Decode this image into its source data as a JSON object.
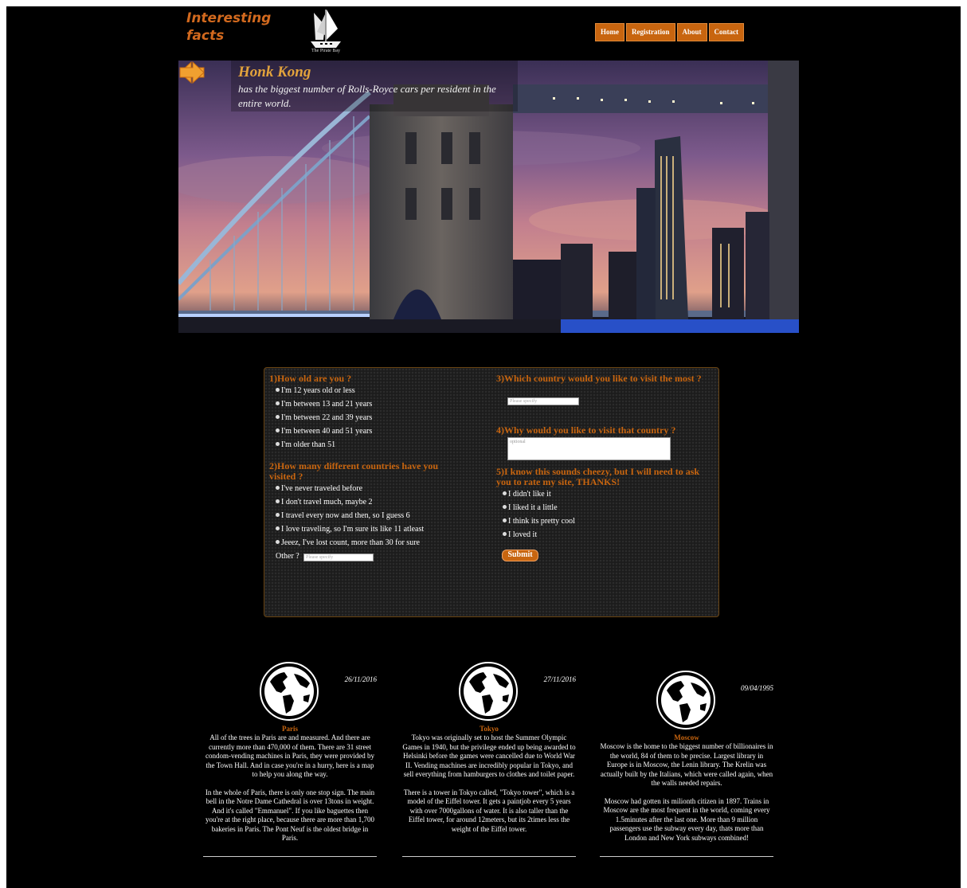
{
  "header": {
    "logo_line1": "Interesting",
    "logo_line2": "facts",
    "brand_caption": "The Pirate Bay"
  },
  "nav": [
    {
      "label": "Home"
    },
    {
      "label": "Registration"
    },
    {
      "label": "About"
    },
    {
      "label": "Contact"
    }
  ],
  "slider": {
    "title": "Honk Kong",
    "text": "has the biggest number of Rolls-Royce cars per resident in the entire world."
  },
  "survey": {
    "q1": {
      "label": "1)How old are you ?",
      "options": [
        "I'm 12 years old or less",
        "I'm between 13 and 21 years",
        "I'm between 22 and 39 years",
        "I'm between 40 and 51 years",
        "I'm older than 51"
      ]
    },
    "q2": {
      "label": "2)How many different countries have you visited ?",
      "options": [
        "I've never traveled before",
        "I don't travel much, maybe 2",
        "I travel every now and then, so I guess 6",
        "I love traveling, so I'm sure its like 11 atleast",
        "Jeeez, I've lost count, more than 30 for sure"
      ],
      "other_label": "Other ?",
      "other_placeholder": "Please specify"
    },
    "q3": {
      "label": "3)Which country would you like to visit the most ?",
      "placeholder": "Please specify"
    },
    "q4": {
      "label": "4)Why would you like to visit that country ?",
      "placeholder": "optional"
    },
    "q5": {
      "label": "5)I know this sounds cheezy, but I will need to ask you to rate my site, THANKS!",
      "options": [
        "I didn't like it",
        "I liked it a little",
        "I think its pretty cool",
        "I loved it"
      ]
    },
    "submit_label": "Submit"
  },
  "cards": [
    {
      "date": "26/11/2016",
      "city": "Paris",
      "para1": "All of the trees in Paris are and measured. And there are currently more than 470,000 of them. There are 31 street condom-vending machines in Paris, they were provided by the Town Hall. And in case you're in a hurry, here is a map to help you along the way.",
      "para2": "In the whole of Paris, there is only one stop sign. The main bell in the Notre Dame Cathedral is over 13tons in weight. And it's called \"Emmanuel\". If you like baguettes then you're at the right place, because there are more than 1,700 bakeries in Paris. The Pont Neuf is the oldest bridge in Paris."
    },
    {
      "date": "27/11/2016",
      "city": "Tokyo",
      "para1": "Tokyo was originally set to host the Summer Olympic Games in 1940, but the privilege ended up being awarded to Helsinki before the games were cancelled due to World War II. Vending machines are incredibly popular in Tokyo, and sell everything from hamburgers to clothes and toilet paper.",
      "para2": "There is a tower in Tokyo called, \"Tokyo tower\", which is a model of the Eiffel tower. It gets a paintjob every 5 years with over 7000gallons of water. It is also taller than the Eiffel tower, for around 12meters, but its 2times less the weight of the Eiffel tower."
    },
    {
      "date": "09/04/1995",
      "city": "Moscow",
      "para1": "Moscow is the home to the biggest number of billionaires in the world, 84 of them to be precise. Largest library in Europe is in Moscow, the Lenin library. The Krelin was actually built by the Italians, which were called again, when the walls needed repairs.",
      "para2": "Moscow had gotten its milionth citizen in 1897. Trains in Moscow are the most frequent in the world, coming every 1.5minutes after the last one. More than 9 million passengers use the subway every day, thats more than London and New York subways combined!"
    }
  ],
  "colors": {
    "accent": "#c8650f",
    "background": "#000000",
    "fact_title": "#e3a33c"
  }
}
